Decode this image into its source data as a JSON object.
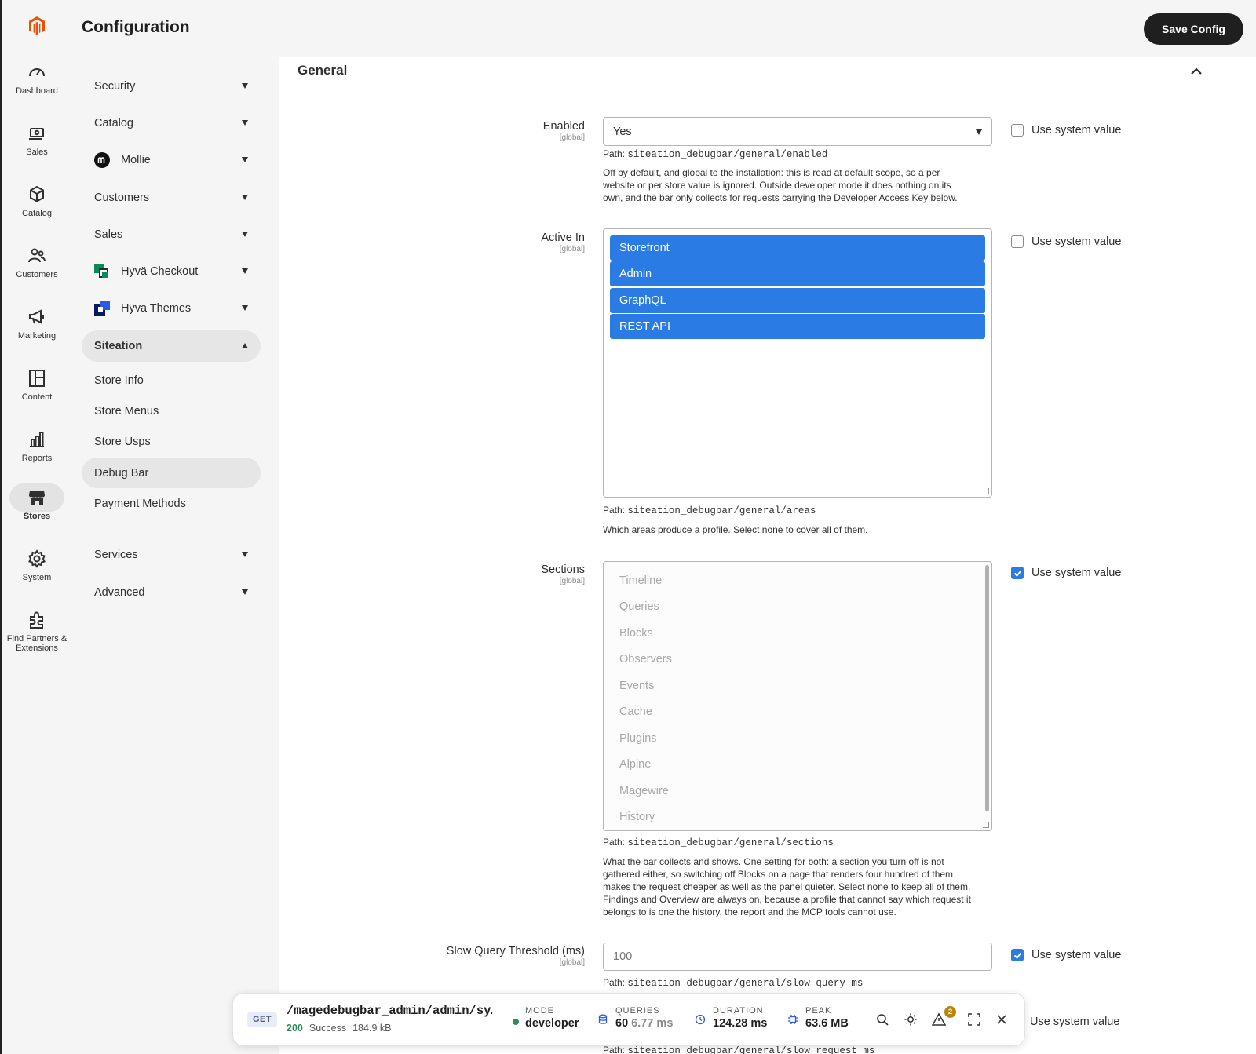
{
  "rail": {
    "items": [
      {
        "label": "Dashboard",
        "icon": "speedometer-icon"
      },
      {
        "label": "Sales",
        "icon": "cash-icon"
      },
      {
        "label": "Catalog",
        "icon": "cube-icon"
      },
      {
        "label": "Customers",
        "icon": "users-icon"
      },
      {
        "label": "Marketing",
        "icon": "megaphone-icon"
      },
      {
        "label": "Content",
        "icon": "layout-icon"
      },
      {
        "label": "Reports",
        "icon": "bar-chart-icon"
      },
      {
        "label": "Stores",
        "icon": "store-icon",
        "active": true
      },
      {
        "label": "System",
        "icon": "gear-icon"
      },
      {
        "label": "Find Partners & Extensions",
        "icon": "puzzle-icon"
      }
    ]
  },
  "header": {
    "title": "Configuration",
    "save_label": "Save Config"
  },
  "nav": {
    "items": [
      {
        "label": "Security"
      },
      {
        "label": "Catalog"
      },
      {
        "label": "Mollie",
        "logo": "mollie-logo"
      },
      {
        "label": "Customers"
      },
      {
        "label": "Sales"
      },
      {
        "label": "Hyvä Checkout",
        "logo": "hyva-checkout-logo"
      },
      {
        "label": "Hyva Themes",
        "logo": "hyva-themes-logo"
      }
    ],
    "open_group": {
      "label": "Siteation",
      "items": [
        "Store Info",
        "Store Menus",
        "Store Usps",
        "Debug Bar",
        "Payment Methods"
      ],
      "active": "Debug Bar"
    },
    "after_items": [
      {
        "label": "Services"
      },
      {
        "label": "Advanced"
      }
    ]
  },
  "section": {
    "title": "General"
  },
  "fields": {
    "enabled": {
      "label": "Enabled",
      "scope": "[global]",
      "value": "Yes",
      "path_prefix": "Path:",
      "path": "siteation_debugbar/general/enabled",
      "note_lines": [
        "Off by default, and global to the installation: this is read at default scope, so a per",
        "website or per store value is ignored. Outside developer mode it does nothing on its",
        "own, and the bar only collects for requests carrying the Developer Access Key below."
      ],
      "use_system": "Use system value",
      "use_system_checked": false
    },
    "active_in": {
      "label": "Active In",
      "scope": "[global]",
      "options": [
        "Storefront",
        "Admin",
        "GraphQL",
        "REST API"
      ],
      "path_prefix": "Path:",
      "path": "siteation_debugbar/general/areas",
      "note": "Which areas produce a profile. Select none to cover all of them.",
      "use_system": "Use system value",
      "use_system_checked": false
    },
    "sections": {
      "label": "Sections",
      "scope": "[global]",
      "options": [
        "Timeline",
        "Queries",
        "Blocks",
        "Observers",
        "Events",
        "Cache",
        "Plugins",
        "Alpine",
        "Magewire",
        "History"
      ],
      "path_prefix": "Path:",
      "path": "siteation_debugbar/general/sections",
      "note_lines": [
        "What the bar collects and shows. One setting for both: a section you turn off is not",
        "gathered either, so switching off Blocks on a page that renders four hundred of them",
        "makes the request cheaper as well as the panel quieter. Select none to keep all of them.",
        "Findings and Overview are always on, because a profile that cannot say which request it",
        "belongs to is one the history, the report and the MCP tools cannot use."
      ],
      "use_system": "Use system value",
      "use_system_checked": true
    },
    "slow_query": {
      "label": "Slow Query Threshold (ms)",
      "scope": "[global]",
      "placeholder": "100",
      "path_prefix": "Path:",
      "path": "siteation_debugbar/general/slow_query_ms",
      "use_system": "Use system value",
      "use_system_checked": true
    },
    "slow_request": {
      "use_system": "Use system value",
      "path_prefix": "Path:",
      "path": "siteation_debugbar/general/slow_request_ms"
    }
  },
  "debugbar": {
    "method": "GET",
    "url": "/magedebugbar_admin/admin/sy…",
    "status_code": "200",
    "status_text": "Success",
    "size": "184.9 kB",
    "mode_label": "MODE",
    "mode_value": "developer",
    "queries_label": "QUERIES",
    "queries_count": "60",
    "queries_time": "6.77 ms",
    "duration_label": "DURATION",
    "duration_value": "124.28 ms",
    "peak_label": "PEAK",
    "peak_value": "63.6 MB",
    "warnings_count": "2"
  },
  "colors": {
    "accent": "#2b7be5",
    "brand": "#eb5202",
    "dark": "#1f1f1f",
    "success": "#2e8b57"
  }
}
